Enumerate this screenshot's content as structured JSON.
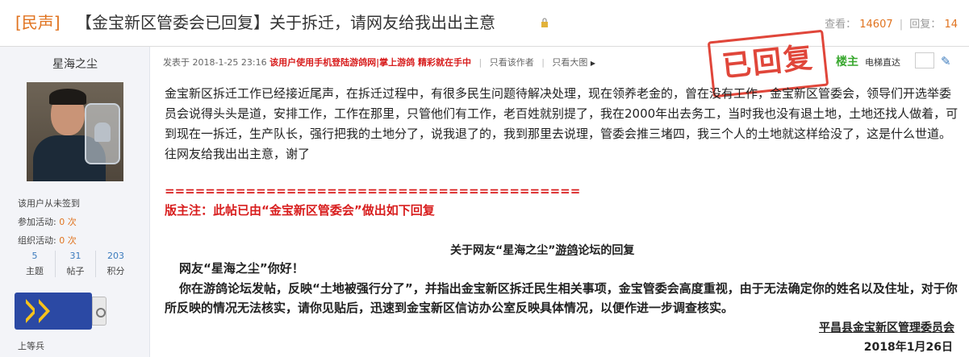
{
  "thread": {
    "tag": "[民声]",
    "title": "【金宝新区管委会已回复】关于拆迁，请网友给我出出主意",
    "views_label": "查看：",
    "views": "14607",
    "replies_label": "回复：",
    "replies": "14"
  },
  "author": {
    "name": "星海之尘",
    "checkin": "该用户从未签到",
    "join_label": "参加活动:",
    "join_count": "0 次",
    "org_label": "组织活动:",
    "org_count": "0 次",
    "stats": [
      {
        "value": "5",
        "label": "主题"
      },
      {
        "value": "31",
        "label": "帖子"
      },
      {
        "value": "203",
        "label": "积分"
      }
    ],
    "rank": "上等兵"
  },
  "post": {
    "posted_prefix": "发表于 2018-1-25 23:16",
    "promo": "该用户使用手机登陆游鸽网|掌上游鸽 精彩就在手中",
    "only_author": "只看该作者",
    "only_images": "只看大图",
    "stamp": "已回复",
    "floor": "楼主",
    "jump_label": "电梯直达",
    "content": "金宝新区拆迁工作已经接近尾声，在拆迁过程中，有很多民生问题待解决处理，现在领养老金的，曾在没有工作，金宝新区管委会，领导们开选举委员会说得头头是道，安排工作，工作在那里，只管他们有工作，老百姓就别提了，我在2000年出去务工，当时我也没有退土地，土地还找人做着，可到现在一拆迁，生产队长，强行把我的土地分了，说我退了的，我到那里去说理，管委会推三堵四，我三个人的土地就这样给没了，这是什么世道。往网友给我出出主意，谢了",
    "divider": "=========================================",
    "moderator_note": "版主注：此帖已由“金宝新区管委会”做出如下回复",
    "reply_title_a": "关于网友“星海之尘”",
    "reply_title_u": "游鸽",
    "reply_title_b": "论坛的回复",
    "reply_greeting": "网友“星海之尘”你好！",
    "reply_body": "你在游鸽论坛发帖，反映“土地被强行分了”，并指出金宝新区拆迁民生相关事项，金宝管委会高度重视，由于无法确定你的姓名以及住址，对于你所反映的情况无法核实，请你见贴后，迅速到金宝新区信访办公室反映具体情况，以便作进一步调查核实。",
    "signature": "平昌县金宝新区管理委员会",
    "date": "2018年1月26日"
  },
  "colors": {
    "accent": "#e0731f",
    "link_blue": "#3c7bbd",
    "alert_red": "#d81d1d",
    "stamp_red": "#e0463a",
    "floor_green": "#39a82f"
  },
  "icons": [
    "lock-icon",
    "triangle-right-icon",
    "edit-pen-icon",
    "rank-badge-icon"
  ]
}
